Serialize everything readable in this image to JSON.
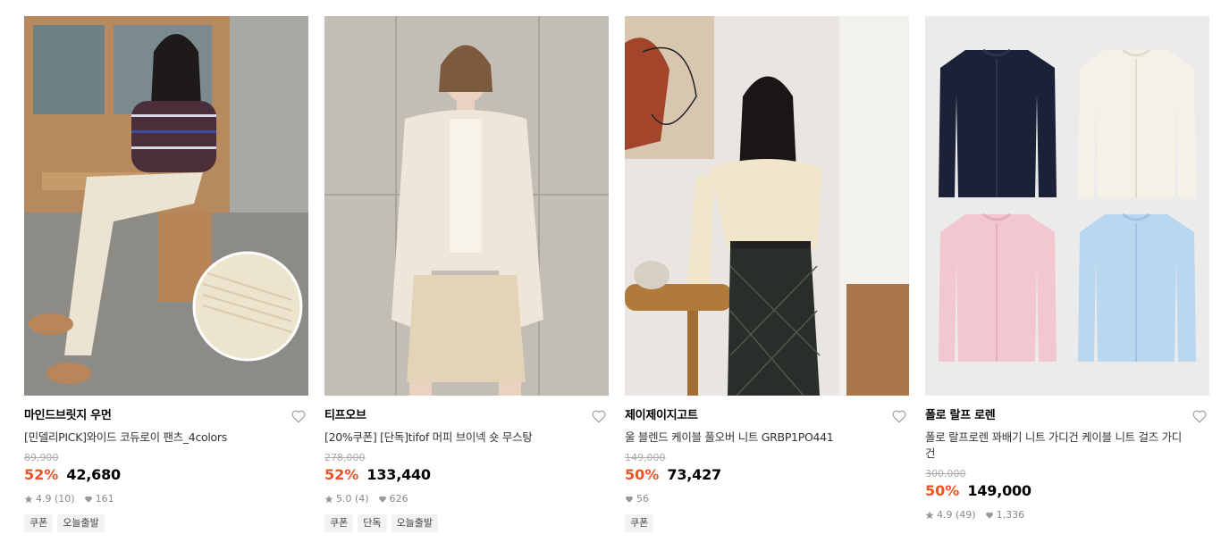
{
  "products": [
    {
      "brand": "마인드브릿지 우먼",
      "name": "[민델리PICK]와이드 코듀로이 팬츠_4colors",
      "original_price": "89,900",
      "discount": "52%",
      "price": "42,680",
      "rating": "4.9",
      "reviews": "(10)",
      "likes": "161",
      "tags": [
        "쿠폰",
        "오늘출발"
      ],
      "image_icon": "photo-woman-corduroy-pants"
    },
    {
      "brand": "티프오브",
      "name": "[20%쿠폰] [단독]tifof 머피 브이넥 숏 무스탕",
      "original_price": "278,000",
      "discount": "52%",
      "price": "133,440",
      "rating": "5.0",
      "reviews": "(4)",
      "likes": "626",
      "tags": [
        "쿠폰",
        "단독",
        "오늘출발"
      ],
      "image_icon": "photo-woman-shearling-jacket"
    },
    {
      "brand": "제이제이지고트",
      "name": "울 블렌드 케이블 풀오버 니트 GRBP1PO441",
      "original_price": "149,000",
      "discount": "50%",
      "price": "73,427",
      "rating": null,
      "reviews": null,
      "likes": "56",
      "tags": [
        "쿠폰"
      ],
      "image_icon": "photo-woman-cable-knit"
    },
    {
      "brand": "폴로 랄프 로렌",
      "name": "폴로 랄프로렌 꽈배기 니트 가디건 케이블 니트 걸즈 가디건",
      "original_price": "300,000",
      "discount": "50%",
      "price": "149,000",
      "rating": "4.9",
      "reviews": "(49)",
      "likes": "1,336",
      "tags": [],
      "image_icon": "photo-cardigans-four-colors"
    }
  ],
  "colors": {
    "discount": "#f4511e",
    "original_price": "#aaaaaa",
    "tag_bg": "#f2f2f2"
  }
}
